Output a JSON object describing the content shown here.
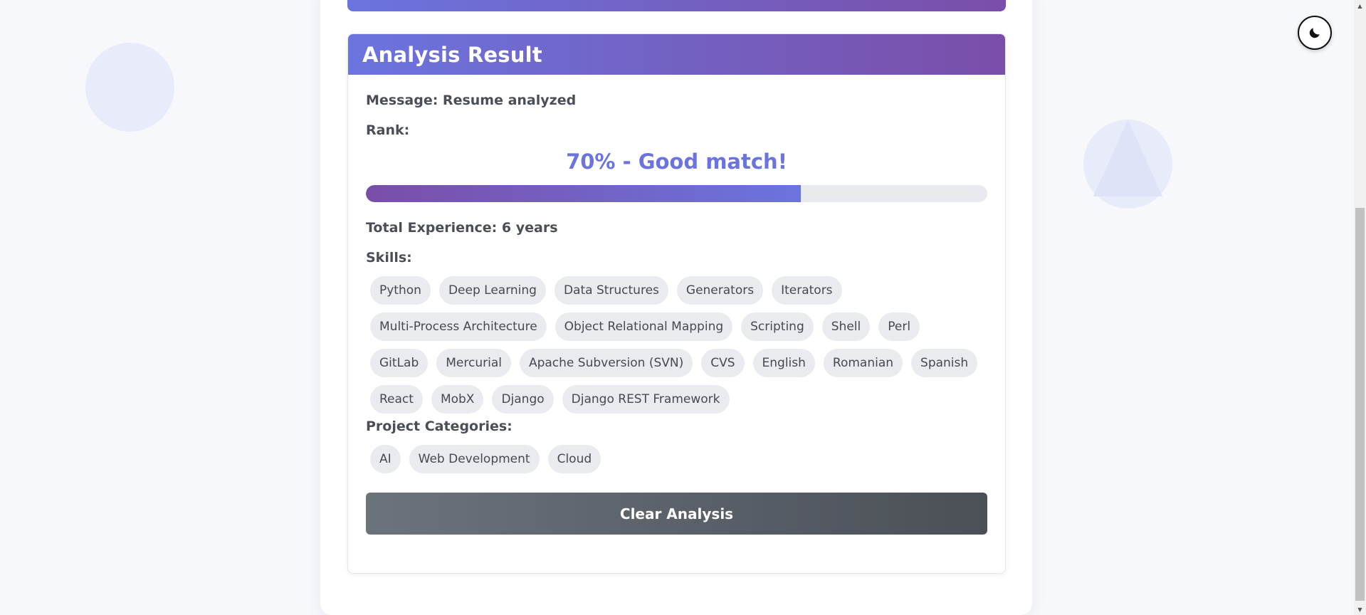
{
  "analysis": {
    "title": "Analysis Result",
    "message": "Message: Resume analyzed",
    "rank_label": "Rank:",
    "rank_text": "70% - Good match!",
    "rank_percent": 70,
    "experience": "Total Experience: 6 years",
    "skills_label": "Skills:",
    "skills": [
      "Python",
      "Deep Learning",
      "Data Structures",
      "Generators",
      "Iterators",
      "Multi-Process Architecture",
      "Object Relational Mapping",
      "Scripting",
      "Shell",
      "Perl",
      "GitLab",
      "Mercurial",
      "Apache Subversion (SVN)",
      "CVS",
      "English",
      "Romanian",
      "Spanish",
      "React",
      "MobX",
      "Django",
      "Django REST Framework"
    ],
    "categories_label": "Project Categories:",
    "categories": [
      "AI",
      "Web Development",
      "Cloud"
    ],
    "clear_button_label": "Clear Analysis"
  },
  "colors": {
    "accent_start": "#6b74de",
    "accent_end": "#7a4ea8",
    "button_start": "#6c737b",
    "button_end": "#4b5057"
  },
  "icons": {
    "theme_toggle": "moon-icon"
  }
}
